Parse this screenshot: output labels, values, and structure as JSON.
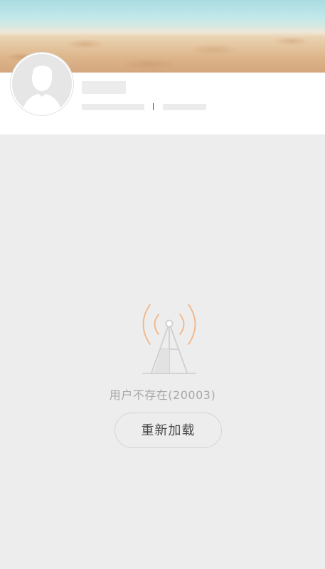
{
  "profile": {
    "cover_image": "beach-sand-photo",
    "avatar": "default-user-silhouette-icon"
  },
  "error": {
    "icon": "signal-tower-icon",
    "message": "用户不存在(20003)",
    "reload_label": "重新加载"
  },
  "colors": {
    "background": "#ededed",
    "card": "#ffffff",
    "signal_wave": "#f3b486",
    "tower": "#cfcfcf",
    "message_text": "#a8a8a8",
    "button_text": "#4a4a4a"
  }
}
